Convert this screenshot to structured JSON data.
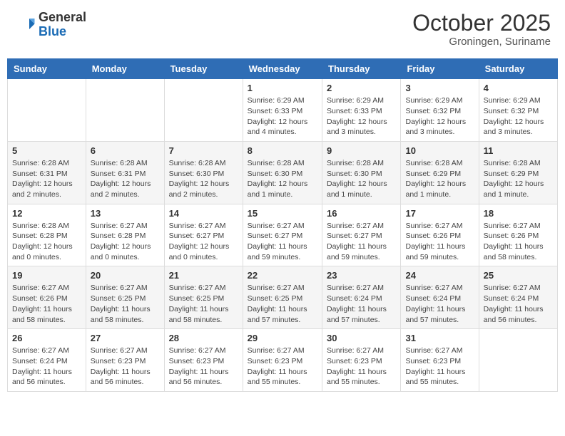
{
  "header": {
    "logo": {
      "general": "General",
      "blue": "Blue"
    },
    "month": "October 2025",
    "location": "Groningen, Suriname"
  },
  "weekdays": [
    "Sunday",
    "Monday",
    "Tuesday",
    "Wednesday",
    "Thursday",
    "Friday",
    "Saturday"
  ],
  "weeks": [
    [
      {
        "day": "",
        "info": ""
      },
      {
        "day": "",
        "info": ""
      },
      {
        "day": "",
        "info": ""
      },
      {
        "day": "1",
        "info": "Sunrise: 6:29 AM\nSunset: 6:33 PM\nDaylight: 12 hours\nand 4 minutes."
      },
      {
        "day": "2",
        "info": "Sunrise: 6:29 AM\nSunset: 6:33 PM\nDaylight: 12 hours\nand 3 minutes."
      },
      {
        "day": "3",
        "info": "Sunrise: 6:29 AM\nSunset: 6:32 PM\nDaylight: 12 hours\nand 3 minutes."
      },
      {
        "day": "4",
        "info": "Sunrise: 6:29 AM\nSunset: 6:32 PM\nDaylight: 12 hours\nand 3 minutes."
      }
    ],
    [
      {
        "day": "5",
        "info": "Sunrise: 6:28 AM\nSunset: 6:31 PM\nDaylight: 12 hours\nand 2 minutes."
      },
      {
        "day": "6",
        "info": "Sunrise: 6:28 AM\nSunset: 6:31 PM\nDaylight: 12 hours\nand 2 minutes."
      },
      {
        "day": "7",
        "info": "Sunrise: 6:28 AM\nSunset: 6:30 PM\nDaylight: 12 hours\nand 2 minutes."
      },
      {
        "day": "8",
        "info": "Sunrise: 6:28 AM\nSunset: 6:30 PM\nDaylight: 12 hours\nand 1 minute."
      },
      {
        "day": "9",
        "info": "Sunrise: 6:28 AM\nSunset: 6:30 PM\nDaylight: 12 hours\nand 1 minute."
      },
      {
        "day": "10",
        "info": "Sunrise: 6:28 AM\nSunset: 6:29 PM\nDaylight: 12 hours\nand 1 minute."
      },
      {
        "day": "11",
        "info": "Sunrise: 6:28 AM\nSunset: 6:29 PM\nDaylight: 12 hours\nand 1 minute."
      }
    ],
    [
      {
        "day": "12",
        "info": "Sunrise: 6:28 AM\nSunset: 6:28 PM\nDaylight: 12 hours\nand 0 minutes."
      },
      {
        "day": "13",
        "info": "Sunrise: 6:27 AM\nSunset: 6:28 PM\nDaylight: 12 hours\nand 0 minutes."
      },
      {
        "day": "14",
        "info": "Sunrise: 6:27 AM\nSunset: 6:27 PM\nDaylight: 12 hours\nand 0 minutes."
      },
      {
        "day": "15",
        "info": "Sunrise: 6:27 AM\nSunset: 6:27 PM\nDaylight: 11 hours\nand 59 minutes."
      },
      {
        "day": "16",
        "info": "Sunrise: 6:27 AM\nSunset: 6:27 PM\nDaylight: 11 hours\nand 59 minutes."
      },
      {
        "day": "17",
        "info": "Sunrise: 6:27 AM\nSunset: 6:26 PM\nDaylight: 11 hours\nand 59 minutes."
      },
      {
        "day": "18",
        "info": "Sunrise: 6:27 AM\nSunset: 6:26 PM\nDaylight: 11 hours\nand 58 minutes."
      }
    ],
    [
      {
        "day": "19",
        "info": "Sunrise: 6:27 AM\nSunset: 6:26 PM\nDaylight: 11 hours\nand 58 minutes."
      },
      {
        "day": "20",
        "info": "Sunrise: 6:27 AM\nSunset: 6:25 PM\nDaylight: 11 hours\nand 58 minutes."
      },
      {
        "day": "21",
        "info": "Sunrise: 6:27 AM\nSunset: 6:25 PM\nDaylight: 11 hours\nand 58 minutes."
      },
      {
        "day": "22",
        "info": "Sunrise: 6:27 AM\nSunset: 6:25 PM\nDaylight: 11 hours\nand 57 minutes."
      },
      {
        "day": "23",
        "info": "Sunrise: 6:27 AM\nSunset: 6:24 PM\nDaylight: 11 hours\nand 57 minutes."
      },
      {
        "day": "24",
        "info": "Sunrise: 6:27 AM\nSunset: 6:24 PM\nDaylight: 11 hours\nand 57 minutes."
      },
      {
        "day": "25",
        "info": "Sunrise: 6:27 AM\nSunset: 6:24 PM\nDaylight: 11 hours\nand 56 minutes."
      }
    ],
    [
      {
        "day": "26",
        "info": "Sunrise: 6:27 AM\nSunset: 6:24 PM\nDaylight: 11 hours\nand 56 minutes."
      },
      {
        "day": "27",
        "info": "Sunrise: 6:27 AM\nSunset: 6:23 PM\nDaylight: 11 hours\nand 56 minutes."
      },
      {
        "day": "28",
        "info": "Sunrise: 6:27 AM\nSunset: 6:23 PM\nDaylight: 11 hours\nand 56 minutes."
      },
      {
        "day": "29",
        "info": "Sunrise: 6:27 AM\nSunset: 6:23 PM\nDaylight: 11 hours\nand 55 minutes."
      },
      {
        "day": "30",
        "info": "Sunrise: 6:27 AM\nSunset: 6:23 PM\nDaylight: 11 hours\nand 55 minutes."
      },
      {
        "day": "31",
        "info": "Sunrise: 6:27 AM\nSunset: 6:23 PM\nDaylight: 11 hours\nand 55 minutes."
      },
      {
        "day": "",
        "info": ""
      }
    ]
  ]
}
